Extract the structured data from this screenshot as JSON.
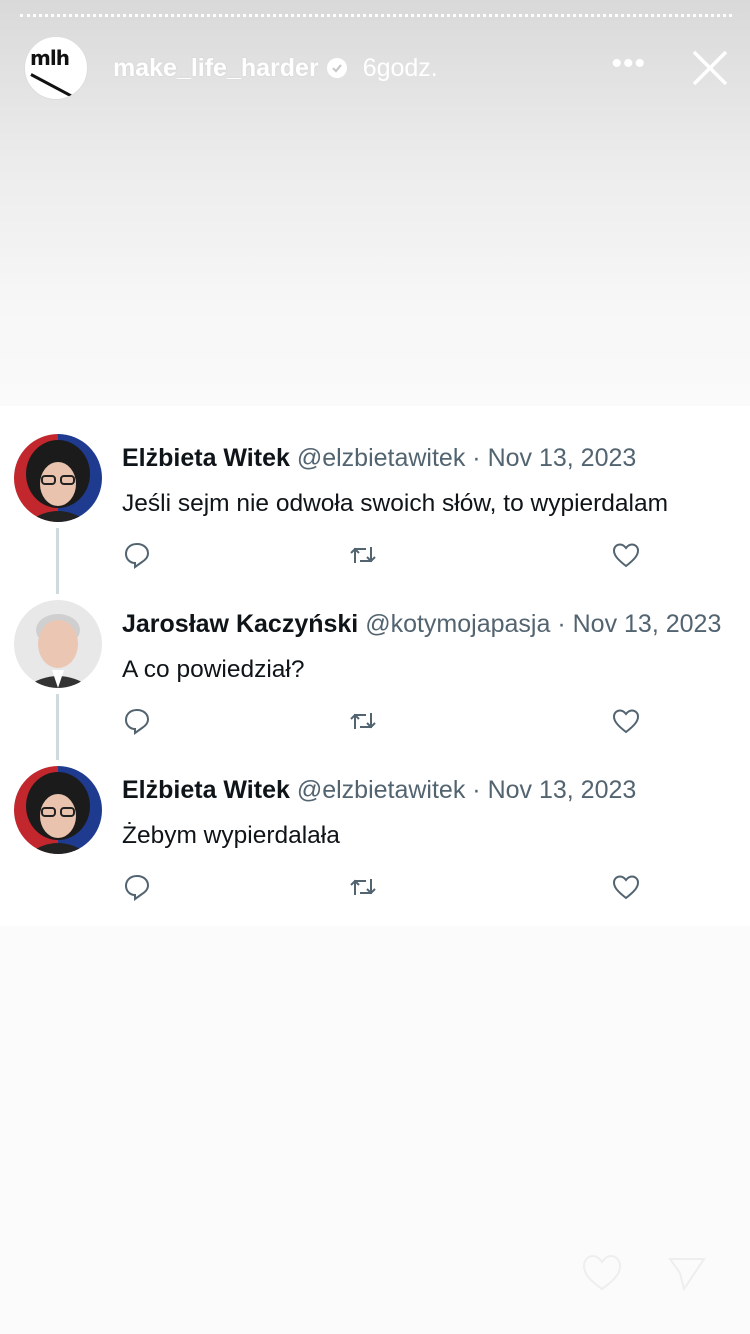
{
  "story": {
    "username": "make_life_harder",
    "time": "6godz.",
    "avatar_text": "mlh",
    "more_icon": "more-horizontal-icon",
    "close_icon": "close-icon"
  },
  "tweets": [
    {
      "name": "Elżbieta Witek",
      "handle": "@elzbietawitek",
      "separator": "·",
      "date": "Nov 13, 2023",
      "text": "Jeśli sejm nie odwoła swoich słów, to wypierdalam"
    },
    {
      "name": "Jarosław Kaczyński",
      "handle": "@kotymojapasja",
      "separator": "·",
      "date": "Nov 13, 2023",
      "text": "A co powiedział?"
    },
    {
      "name": "Elżbieta Witek",
      "handle": "@elzbietawitek",
      "separator": "·",
      "date": "Nov 13, 2023",
      "text": "Żebym wypierdalała"
    }
  ],
  "colors": {
    "text_primary": "#0f1419",
    "text_secondary": "#536471",
    "thread_line": "#cfd9de"
  }
}
